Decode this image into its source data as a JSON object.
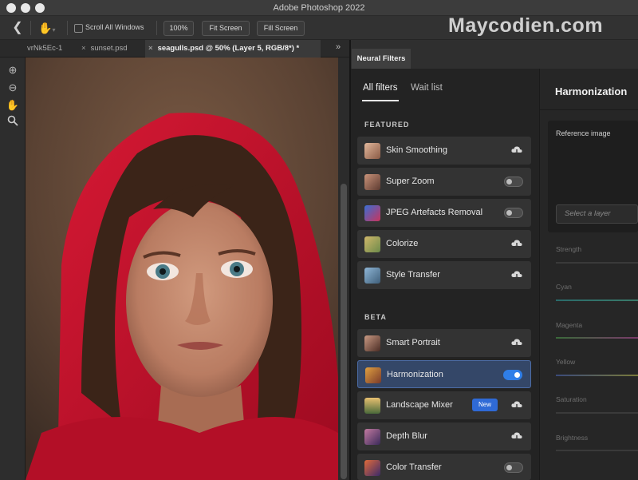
{
  "window": {
    "title": "Adobe Photoshop 2022"
  },
  "watermark": "Maycodien.com",
  "options_bar": {
    "scroll_all_label": "Scroll All Windows",
    "zoom_100": "100%",
    "fit_screen": "Fit Screen",
    "fill_screen": "Fill Screen"
  },
  "doc_tabs": [
    {
      "label": "vrNk5Ec-1",
      "active": false
    },
    {
      "label": "sunset.psd",
      "active": false
    },
    {
      "label": "seagulls.psd @ 50% (Layer 5, RGB/8*) *",
      "active": true
    }
  ],
  "neural_filters": {
    "panel_tab": "Neural Filters",
    "subtabs": [
      "All filters",
      "Wait list"
    ],
    "featured_heading": "FEATURED",
    "beta_heading": "BETA",
    "featured": [
      {
        "label": "Skin Smoothing",
        "control": "cloud"
      },
      {
        "label": "Super Zoom",
        "control": "toggle-off"
      },
      {
        "label": "JPEG Artefacts Removal",
        "control": "toggle-off"
      },
      {
        "label": "Colorize",
        "control": "cloud"
      },
      {
        "label": "Style Transfer",
        "control": "cloud"
      }
    ],
    "beta": [
      {
        "label": "Smart Portrait",
        "control": "cloud"
      },
      {
        "label": "Harmonization",
        "control": "toggle-on",
        "selected": true
      },
      {
        "label": "Landscape Mixer",
        "control": "cloud",
        "badge": "New"
      },
      {
        "label": "Depth Blur",
        "control": "cloud"
      },
      {
        "label": "Color Transfer",
        "control": "toggle-off"
      }
    ]
  },
  "detail": {
    "title": "Harmonization",
    "reference_label": "Reference image",
    "layer_placeholder": "Select a layer",
    "sliders": [
      "Strength",
      "Cyan",
      "Magenta",
      "Yellow",
      "Saturation",
      "Brightness"
    ]
  },
  "colors": {
    "accent": "#2f7ee8",
    "selected_row": "#344768",
    "hood_red": "#c4122a"
  },
  "icons": [
    "back-arrow-icon",
    "hand-icon",
    "zoom-in-icon",
    "zoom-out-icon",
    "hand-tool-icon",
    "magnifier-icon",
    "cloud-download-icon",
    "panel-collapse-icon"
  ]
}
